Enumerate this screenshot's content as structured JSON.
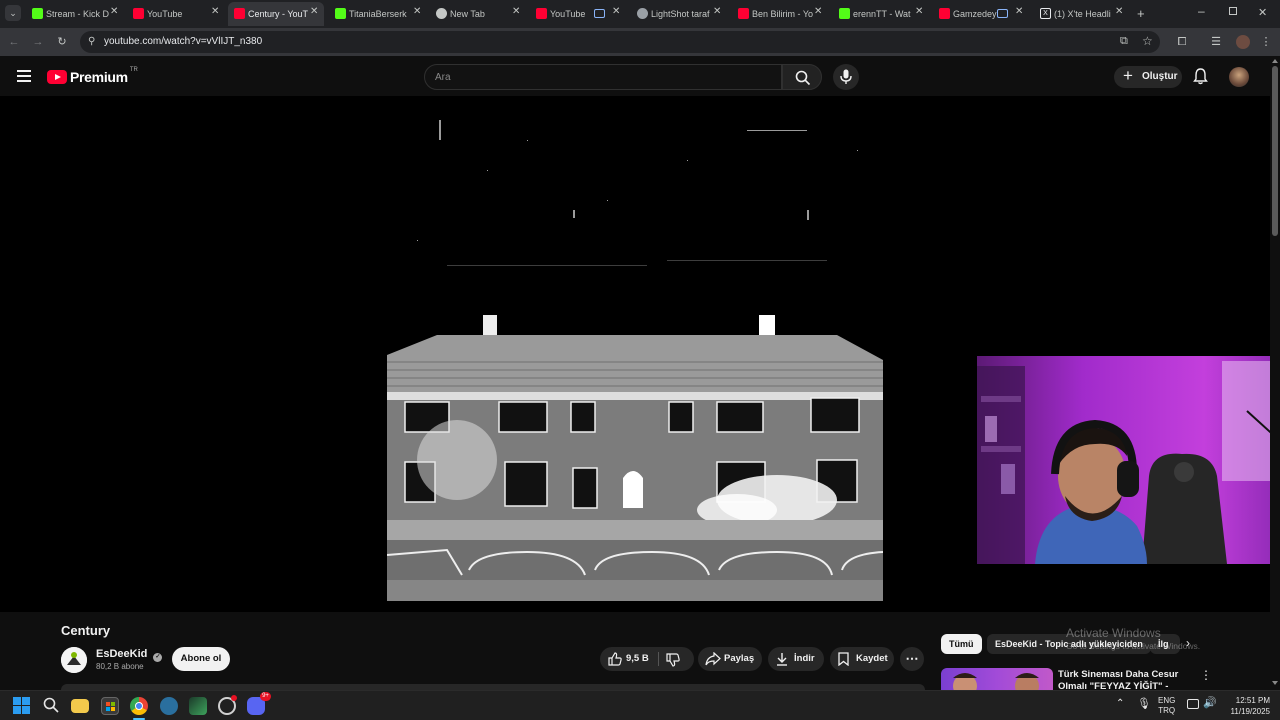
{
  "browser": {
    "tabs": [
      {
        "title": "Stream - Kick D",
        "favicon_color": "#53fc18"
      },
      {
        "title": "YouTube",
        "favicon_color": "#ff0033"
      },
      {
        "title": "Century - YouT",
        "favicon_color": "#ff0033",
        "active": true
      },
      {
        "title": "TitaniaBerserk",
        "favicon_color": "#53fc18"
      },
      {
        "title": "New Tab",
        "favicon_color": "#c4c7c5"
      },
      {
        "title": "YouTube",
        "favicon_color": "#ff0033"
      },
      {
        "title": "LightShot taraf",
        "favicon_color": "#9aa0a6"
      },
      {
        "title": "Ben Bilirim - Yo",
        "favicon_color": "#ff0033"
      },
      {
        "title": "erennTT - Wat",
        "favicon_color": "#53fc18"
      },
      {
        "title": "Gamzedey",
        "favicon_color": "#ff0033"
      },
      {
        "title": "(1) X'te Headli",
        "favicon_color": "#e8eaed"
      }
    ],
    "url": "youtube.com/watch?v=vVlIJT_n380"
  },
  "youtube": {
    "logo_text": "Premium",
    "logo_region": "TR",
    "search_placeholder": "Ara",
    "create_label": "Oluştur",
    "brand_color": "#ff0033"
  },
  "video": {
    "title": "Century",
    "channel": "EsDeeKid",
    "subscribers": "80,2 B abone",
    "subscribe_label": "Abone ol",
    "likes": "9,5 B",
    "share_label": "Paylaş",
    "download_label": "İndir",
    "save_label": "Kaydet"
  },
  "sidebar": {
    "chips": [
      "Tümü",
      "EsDeeKid - Topic adlı yükleyiciden",
      "İlg"
    ],
    "recommendation_title_1": "Türk Sineması Daha Cesur",
    "recommendation_title_2": "Olmalı \"FEYYAZ YİĞİT\" -"
  },
  "watermark": {
    "line1": "Activate Windows",
    "line2": "Go to Settings to activate Windows."
  },
  "taskbar": {
    "language": "ENG",
    "layout": "TRQ",
    "time": "12:51 PM",
    "date": "11/19/2025",
    "discord_badge": "9+"
  }
}
